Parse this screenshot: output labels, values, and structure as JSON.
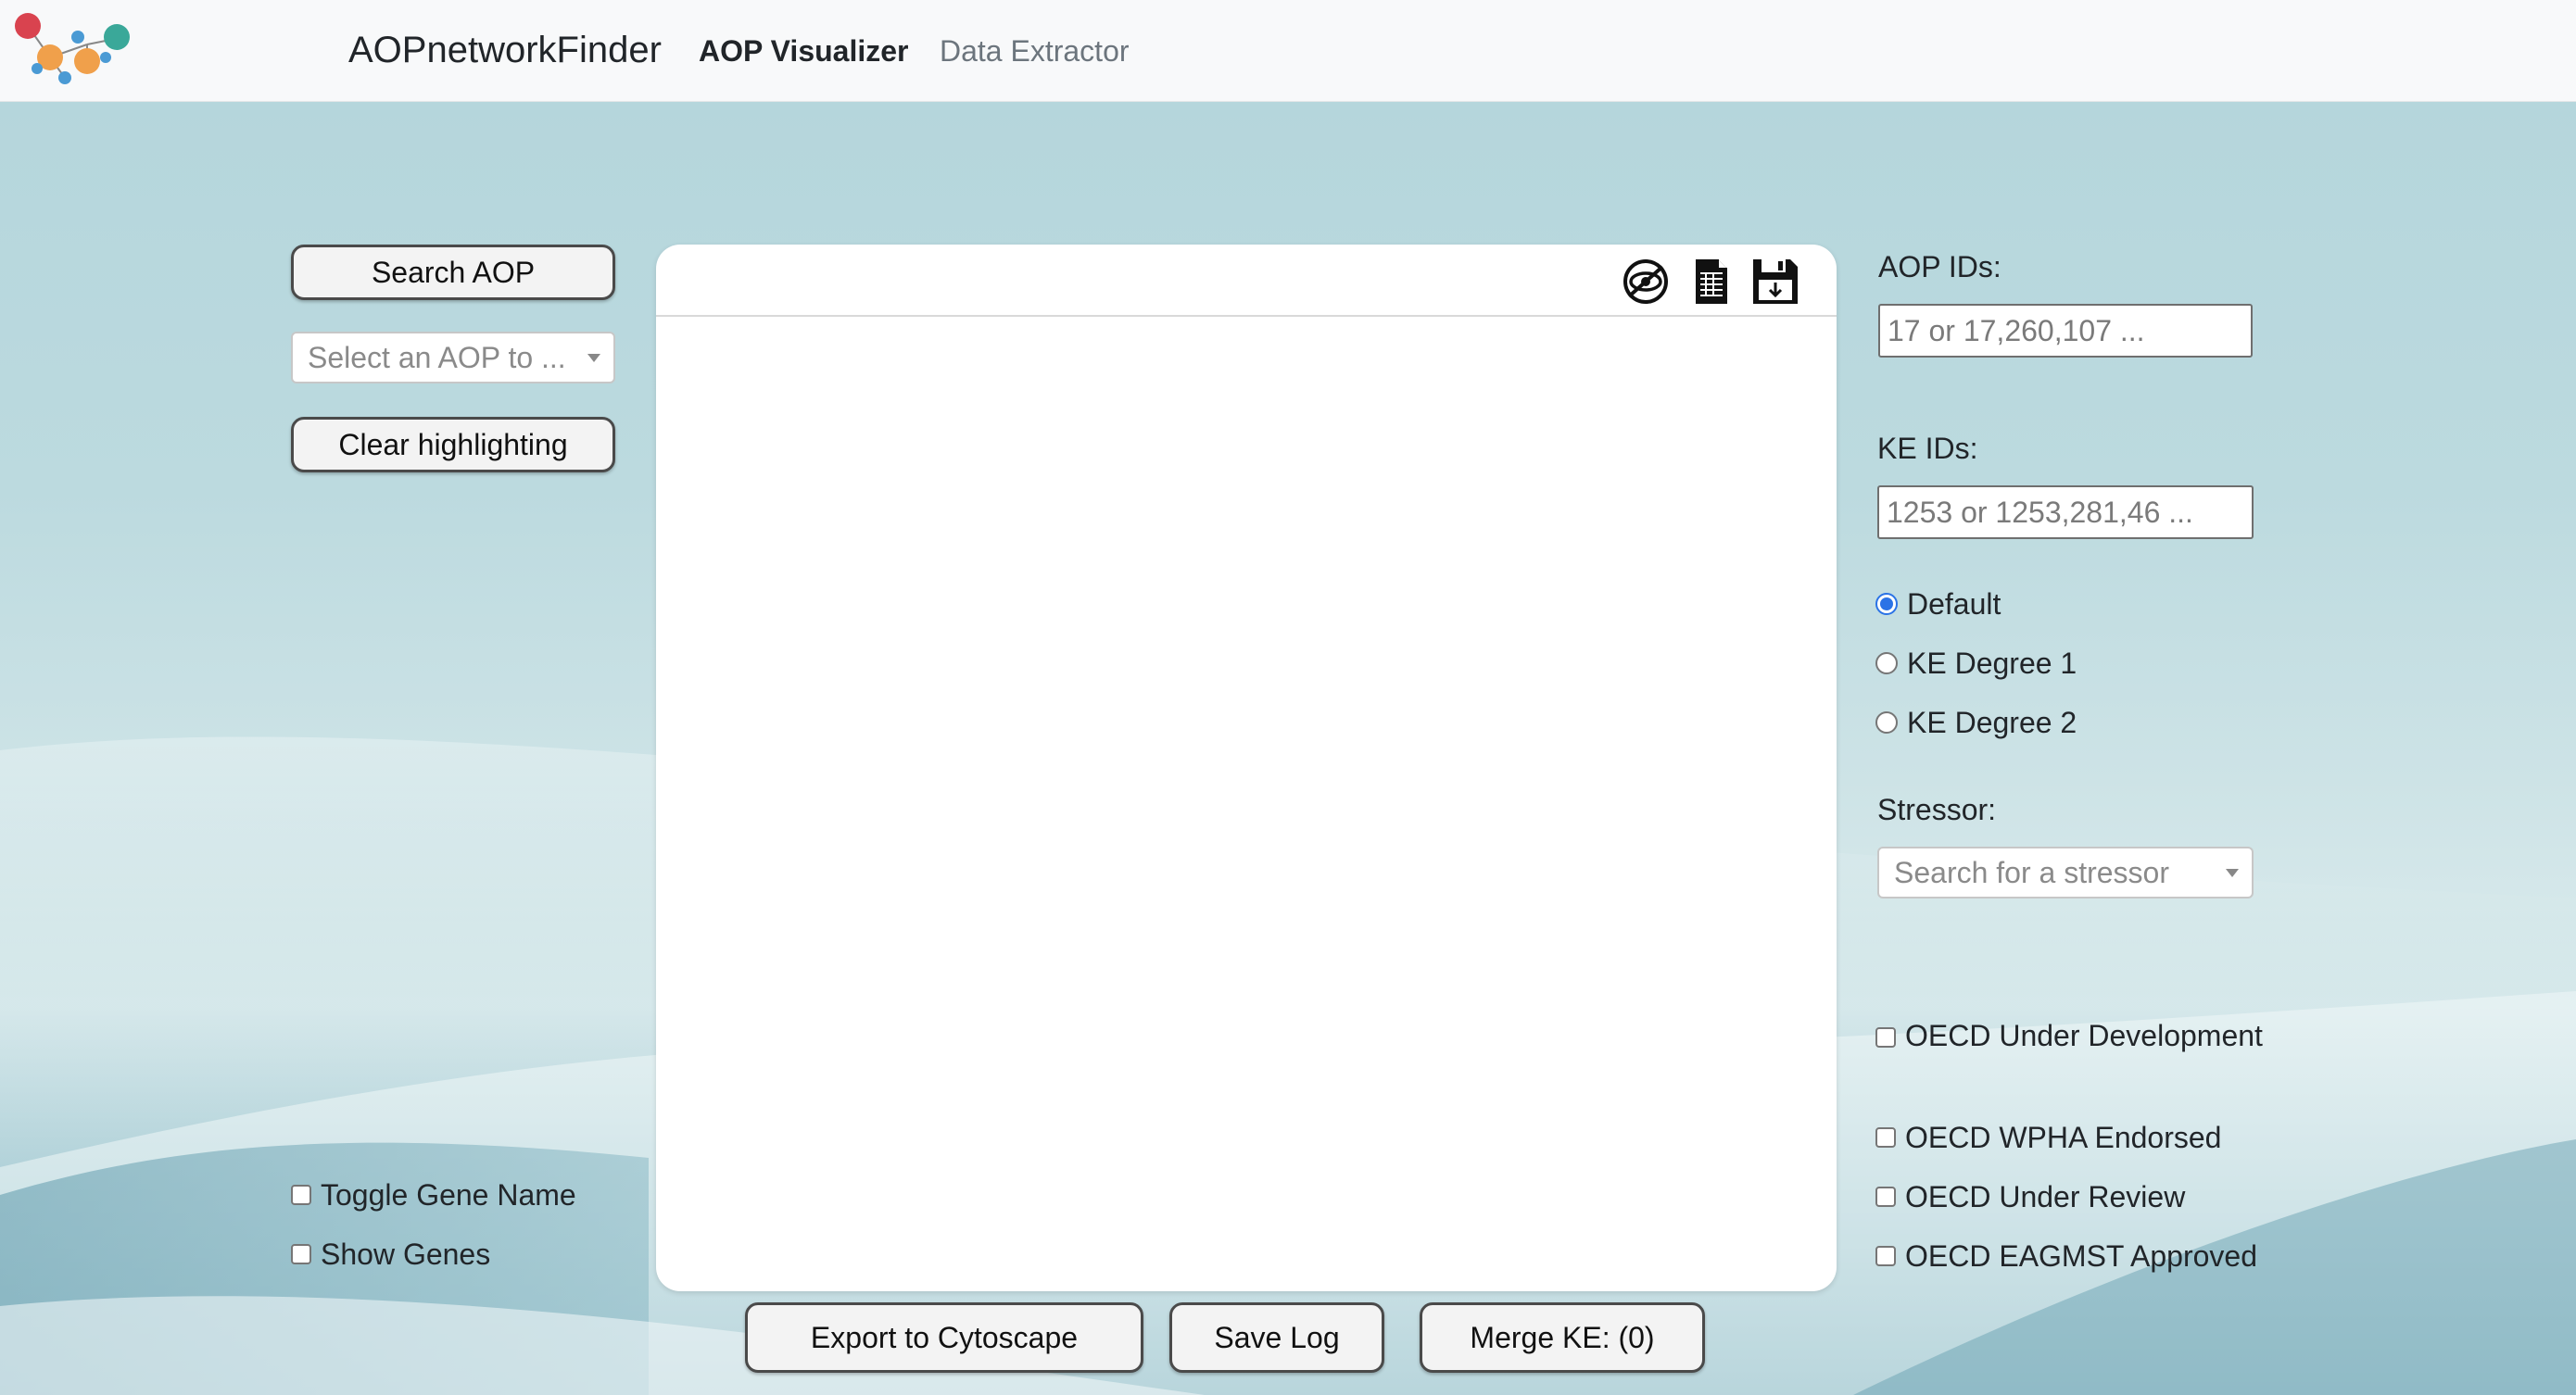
{
  "navbar": {
    "brand": "AOPnetworkFinder",
    "links": [
      {
        "label": "AOP Visualizer",
        "active": true
      },
      {
        "label": "Data Extractor",
        "active": false
      }
    ]
  },
  "left_panel": {
    "search_button": "Search AOP",
    "aop_select_placeholder": "Select an AOP to ...",
    "clear_button": "Clear highlighting",
    "toggle_gene_name": "Toggle Gene Name",
    "show_genes": "Show Genes"
  },
  "canvas": {
    "toolbar_icons": [
      "hide-icon",
      "document-icon",
      "save-icon"
    ]
  },
  "bottom_buttons": {
    "export": "Export to Cytoscape",
    "save_log": "Save Log",
    "merge_ke": "Merge KE: (0)"
  },
  "right_panel": {
    "aop_ids_label": "AOP IDs:",
    "aop_ids_placeholder": "17 or 17,260,107 ...",
    "ke_ids_label": "KE IDs:",
    "ke_ids_placeholder": "1253 or 1253,281,46 ...",
    "degree_options": [
      {
        "label": "Default",
        "checked": true
      },
      {
        "label": "KE Degree 1",
        "checked": false
      },
      {
        "label": "KE Degree 2",
        "checked": false
      }
    ],
    "stressor_label": "Stressor:",
    "stressor_placeholder": "Search for a stressor",
    "oecd_filters": [
      "OECD Under Development",
      "OECD WPHA Endorsed",
      "OECD Under Review",
      "OECD EAGMST Approved"
    ]
  },
  "colors": {
    "accent_radio": "#2b73e6",
    "logo_red": "#d9434f",
    "logo_orange": "#f0a04b",
    "logo_blue": "#4a9ad4",
    "logo_teal": "#3aa899"
  }
}
